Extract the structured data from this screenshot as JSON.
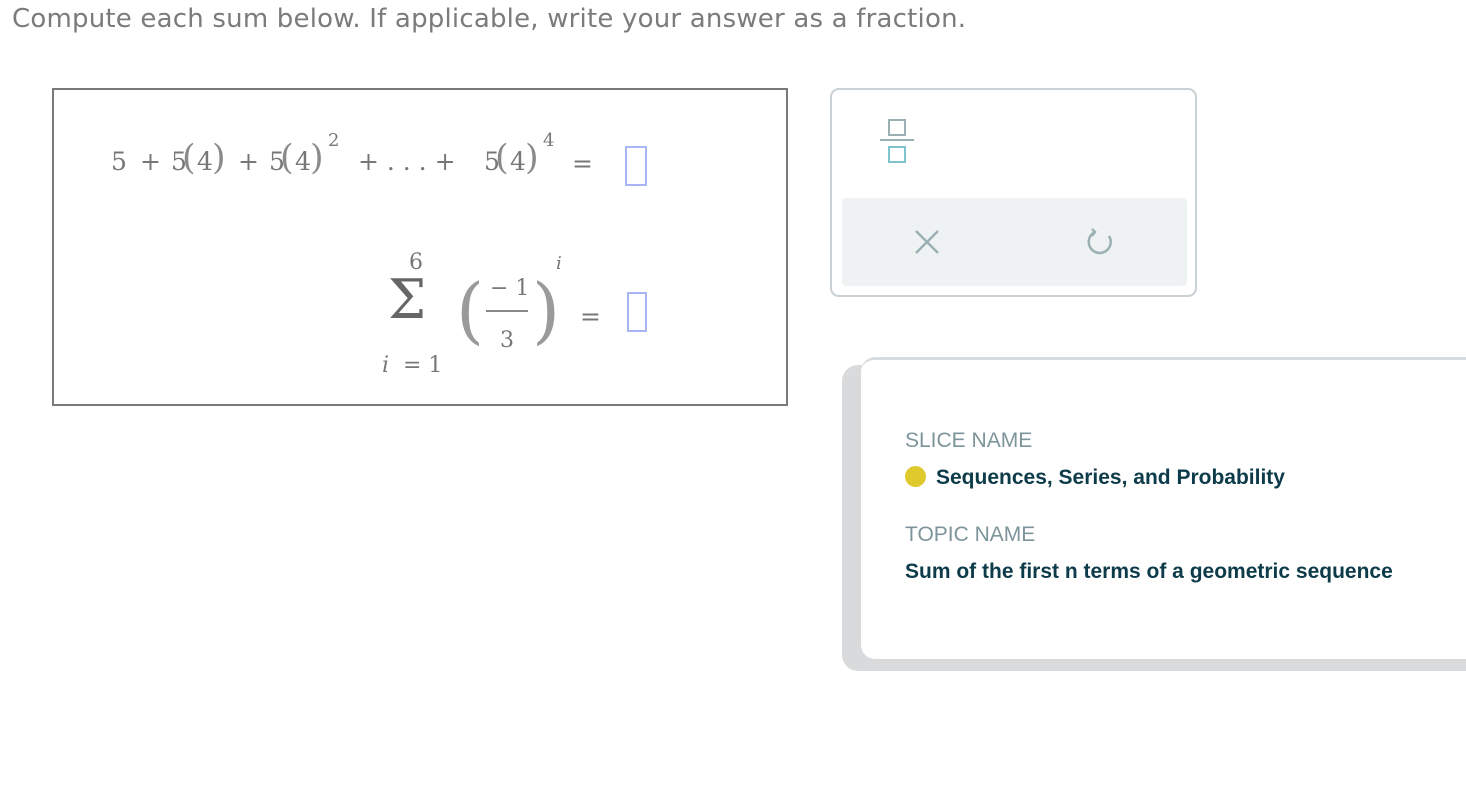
{
  "instruction": "Compute each sum below. If applicable, write your answer as a fraction.",
  "problem1": {
    "t1": "5",
    "plus": "+",
    "coef": "5",
    "base": "4",
    "exp2": "2",
    "dots": "+ . . . +",
    "exp4": "4",
    "equals": "="
  },
  "problem2": {
    "upper": "6",
    "sigma": "Σ",
    "lower_var": "i",
    "lower_eq": "= 1",
    "numerator": "− 1",
    "denominator": "3",
    "exponent": "i",
    "equals": "="
  },
  "keypad": {
    "fraction_icon": "fraction-icon",
    "clear_icon": "close-icon",
    "undo_icon": "undo-icon",
    "icon_color": "#9bb0b3"
  },
  "info": {
    "slice_label": "SLICE NAME",
    "slice_value": "Sequences, Series, and Probability",
    "slice_color": "#e0c92d",
    "topic_label": "TOPIC NAME",
    "topic_value": "Sum of the first n terms of a geometric sequence"
  }
}
